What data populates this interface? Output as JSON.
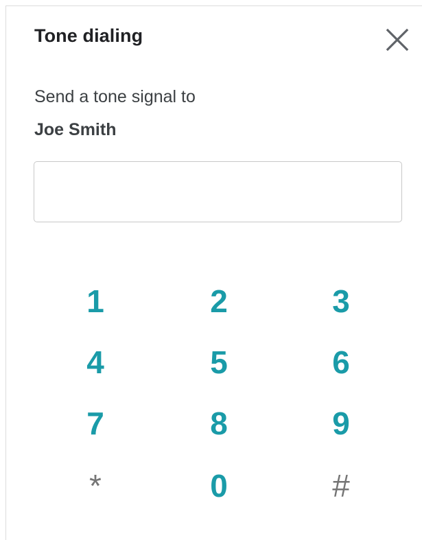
{
  "dialog": {
    "title": "Tone dialing",
    "close_icon": "close-icon",
    "subtitle": "Send a tone signal to",
    "contact_name": "Joe Smith",
    "input_value": "",
    "input_placeholder": ""
  },
  "keypad": {
    "keys": [
      "1",
      "2",
      "3",
      "4",
      "5",
      "6",
      "7",
      "8",
      "9",
      "*",
      "0",
      "#"
    ]
  },
  "colors": {
    "digit": "#1a9ba8",
    "symbol": "#757575",
    "title": "#202124",
    "border": "#c8c8c8"
  }
}
